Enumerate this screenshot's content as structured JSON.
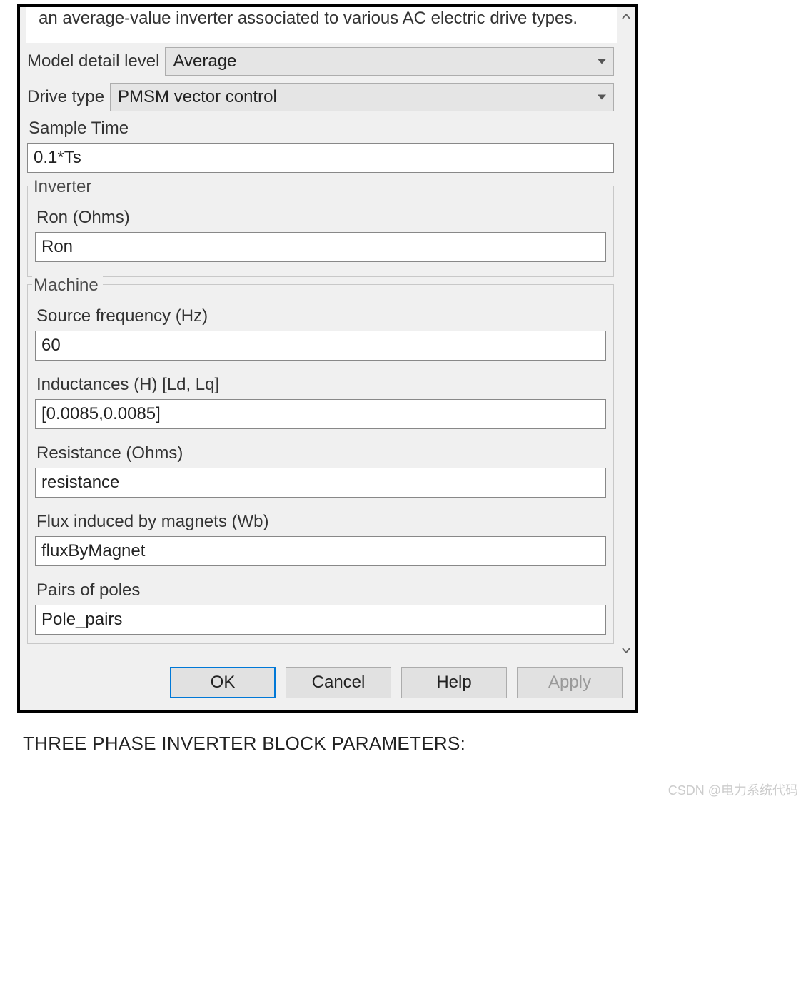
{
  "description": "an average-value inverter associated to various AC electric drive types.",
  "fields": {
    "model_detail_level": {
      "label": "Model detail level",
      "value": "Average"
    },
    "drive_type": {
      "label": "Drive type",
      "value": "PMSM vector control"
    },
    "sample_time": {
      "label": "Sample Time",
      "value": "0.1*Ts"
    }
  },
  "inverter": {
    "legend": "Inverter",
    "ron": {
      "label": "Ron (Ohms)",
      "value": "Ron"
    }
  },
  "machine": {
    "legend": "Machine",
    "source_frequency": {
      "label": "Source frequency (Hz)",
      "value": "60"
    },
    "inductances": {
      "label": "Inductances (H) [Ld, Lq]",
      "value": "[0.0085,0.0085]"
    },
    "resistance": {
      "label": "Resistance (Ohms)",
      "value": "resistance"
    },
    "flux": {
      "label": "Flux induced by magnets (Wb)",
      "value": "fluxByMagnet"
    },
    "pole_pairs": {
      "label": "Pairs of poles",
      "value": "Pole_pairs"
    }
  },
  "buttons": {
    "ok": "OK",
    "cancel": "Cancel",
    "help": "Help",
    "apply": "Apply"
  },
  "caption": "THREE PHASE INVERTER BLOCK PARAMETERS:",
  "watermark": "CSDN @电力系统代码"
}
